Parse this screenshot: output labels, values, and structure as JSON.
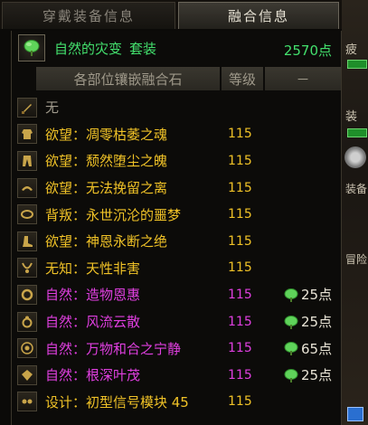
{
  "tabs": [
    {
      "label": "穿戴装备信息",
      "active": false
    },
    {
      "label": "融合信息",
      "active": true
    }
  ],
  "set": {
    "name": "自然的灾变",
    "type": "套装",
    "points": "2570点",
    "icon": "leaf-icon"
  },
  "columns": {
    "name": "各部位镶嵌融合石",
    "level": "等级",
    "extra": "－"
  },
  "rows": [
    {
      "slot_icon": "weapon-slot-icon",
      "text": "无",
      "level": "",
      "bonus": "",
      "color": "gray"
    },
    {
      "slot_icon": "top-slot-icon",
      "text": "欲望：凋零枯萎之魂",
      "level": "115",
      "bonus": "",
      "color": "gold"
    },
    {
      "slot_icon": "bottom-slot-icon",
      "text": "欲望：颓然堕尘之魄",
      "level": "115",
      "bonus": "",
      "color": "gold"
    },
    {
      "slot_icon": "shoulder-slot-icon",
      "text": "欲望：无法挽留之离",
      "level": "115",
      "bonus": "",
      "color": "gold"
    },
    {
      "slot_icon": "belt-slot-icon",
      "text": "背叛：永世沉沦的噩梦",
      "level": "115",
      "bonus": "",
      "color": "gold"
    },
    {
      "slot_icon": "shoes-slot-icon",
      "text": "欲望：神恩永断之绝",
      "level": "115",
      "bonus": "",
      "color": "gold"
    },
    {
      "slot_icon": "necklace-slot-icon",
      "text": "无知：天性非害",
      "level": "115",
      "bonus": "",
      "color": "gold"
    },
    {
      "slot_icon": "bracelet-slot-icon",
      "text": "自然：造物恩惠",
      "level": "115",
      "bonus": "25点",
      "color": "pink"
    },
    {
      "slot_icon": "ring-slot-icon",
      "text": "自然：风流云散",
      "level": "115",
      "bonus": "25点",
      "color": "pink"
    },
    {
      "slot_icon": "support-slot-icon",
      "text": "自然：万物和合之宁静",
      "level": "115",
      "bonus": "65点",
      "color": "pink"
    },
    {
      "slot_icon": "magic-stone-slot-icon",
      "text": "自然：根深叶茂",
      "level": "115",
      "bonus": "25点",
      "color": "pink"
    },
    {
      "slot_icon": "earring-slot-icon",
      "text": "设计：初型信号模块 45",
      "level": "115",
      "bonus": "",
      "color": "gold"
    }
  ],
  "background_ui": {
    "fragments": [
      "疲",
      "装",
      "装备",
      "冒险"
    ]
  },
  "colors": {
    "gold": "#f0c227",
    "pink": "#e03fe0",
    "green": "#43e06d",
    "gray": "#a09a8c"
  }
}
